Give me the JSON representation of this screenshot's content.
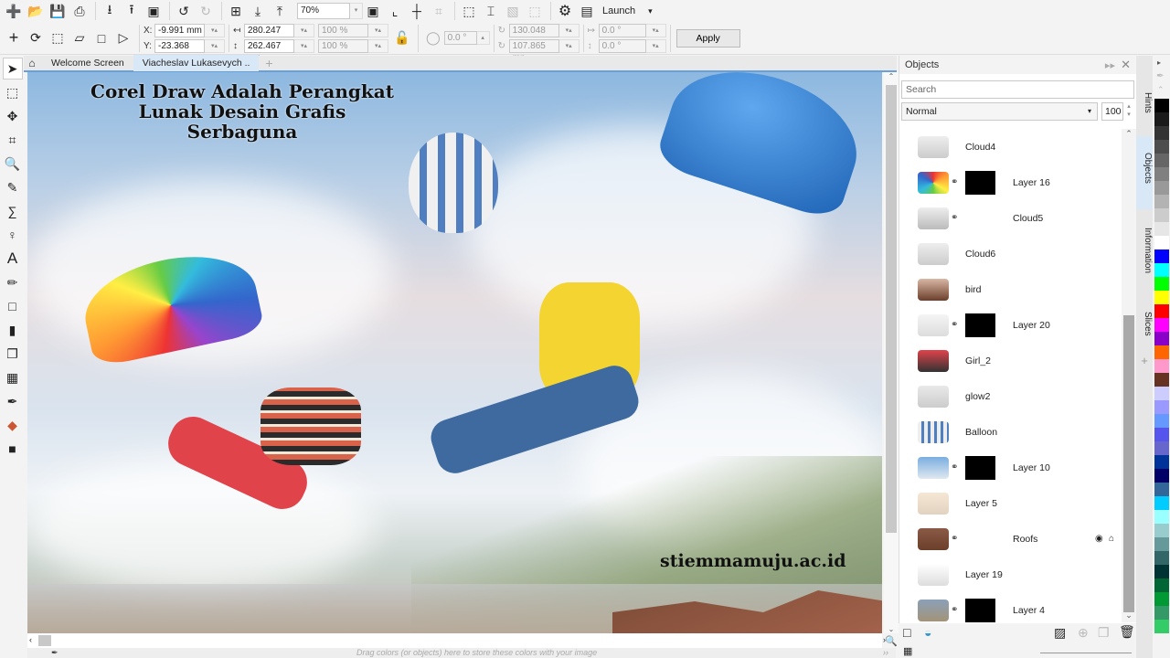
{
  "toolbar": {
    "zoom_value": "70%",
    "launch_label": "Launch",
    "apply_label": "Apply",
    "icons": [
      "new-document-icon",
      "open-icon",
      "save-icon",
      "print-icon",
      "import-icon",
      "export-icon",
      "publish-pdf-icon",
      "undo-icon",
      "redo-icon",
      "snap-icon",
      "import-arrow-icon",
      "export-arrow-icon",
      "fullscreen-icon",
      "rulers-icon",
      "guidelines-icon",
      "grid-icon",
      "page-border-icon",
      "page-frame-icon",
      "bleed-icon",
      "printable-area-icon",
      "options-gear-icon",
      "launch-icon"
    ]
  },
  "property_bar": {
    "x_label": "X:",
    "y_label": "Y:",
    "x_value": "-9.991 mm",
    "y_value": "-23.368 mm",
    "width_value": "280.247 mn",
    "height_value": "262.467 mn",
    "scale_x": "100 %",
    "scale_y": "100 %",
    "rotation": "0.0 °",
    "center_x": "130.048 mn",
    "center_y": "107.865 mn",
    "skew_h": "0.0 °",
    "skew_v": "0.0 °"
  },
  "tabs": [
    {
      "label": "Welcome Screen",
      "active": false
    },
    {
      "label": "Viacheslav Lukasevych ..",
      "active": true
    }
  ],
  "canvas": {
    "title_line1": "Corel Draw Adalah Perangkat",
    "title_line2": "Lunak Desain Grafis Serbaguna",
    "watermark": "stiemmamuju.ac.id"
  },
  "status": {
    "hint": "Drag colors (or objects) here to store these colors with your image"
  },
  "objects_panel": {
    "title": "Objects",
    "search_placeholder": "Search",
    "blend_mode": "Normal",
    "opacity": "100",
    "items": [
      {
        "name": "Cloud4",
        "linked": false,
        "mask": false
      },
      {
        "name": "Layer 16",
        "linked": true,
        "mask": true
      },
      {
        "name": "Cloud5",
        "linked": true,
        "mask": false
      },
      {
        "name": "Cloud6",
        "linked": false,
        "mask": false
      },
      {
        "name": "bird",
        "linked": false,
        "mask": false
      },
      {
        "name": "Layer 20",
        "linked": true,
        "mask": true
      },
      {
        "name": "Girl_2",
        "linked": false,
        "mask": false
      },
      {
        "name": "glow2",
        "linked": false,
        "mask": false
      },
      {
        "name": "Balloon",
        "linked": false,
        "mask": false
      },
      {
        "name": "Layer 10",
        "linked": true,
        "mask": true
      },
      {
        "name": "Layer 5",
        "linked": false,
        "mask": false
      },
      {
        "name": "Roofs",
        "linked": true,
        "mask": false,
        "hovered": true
      },
      {
        "name": "Layer 19",
        "linked": false,
        "mask": false
      },
      {
        "name": "Layer 4",
        "linked": true,
        "mask": true
      }
    ]
  },
  "docker_tabs": [
    "Hints",
    "Objects",
    "Information",
    "Slices"
  ],
  "palette": [
    "#000000",
    "#1a1a1a",
    "#333333",
    "#4d4d4d",
    "#666666",
    "#808080",
    "#999999",
    "#b3b3b3",
    "#cccccc",
    "#e6e6e6",
    "#ffffff",
    "#0000ff",
    "#00ffff",
    "#00ff00",
    "#ffff00",
    "#ff0000",
    "#ff00ff",
    "#8a00c8",
    "#ff6600",
    "#ff99cc",
    "#663322",
    "#ccccff",
    "#9999ff",
    "#6699ff",
    "#5555ee",
    "#6666cc",
    "#003399",
    "#000066",
    "#336699",
    "#00ccff",
    "#99ffff",
    "#99cccc",
    "#669999",
    "#336666",
    "#003333",
    "#006633",
    "#009933",
    "#339966",
    "#33cc66"
  ]
}
